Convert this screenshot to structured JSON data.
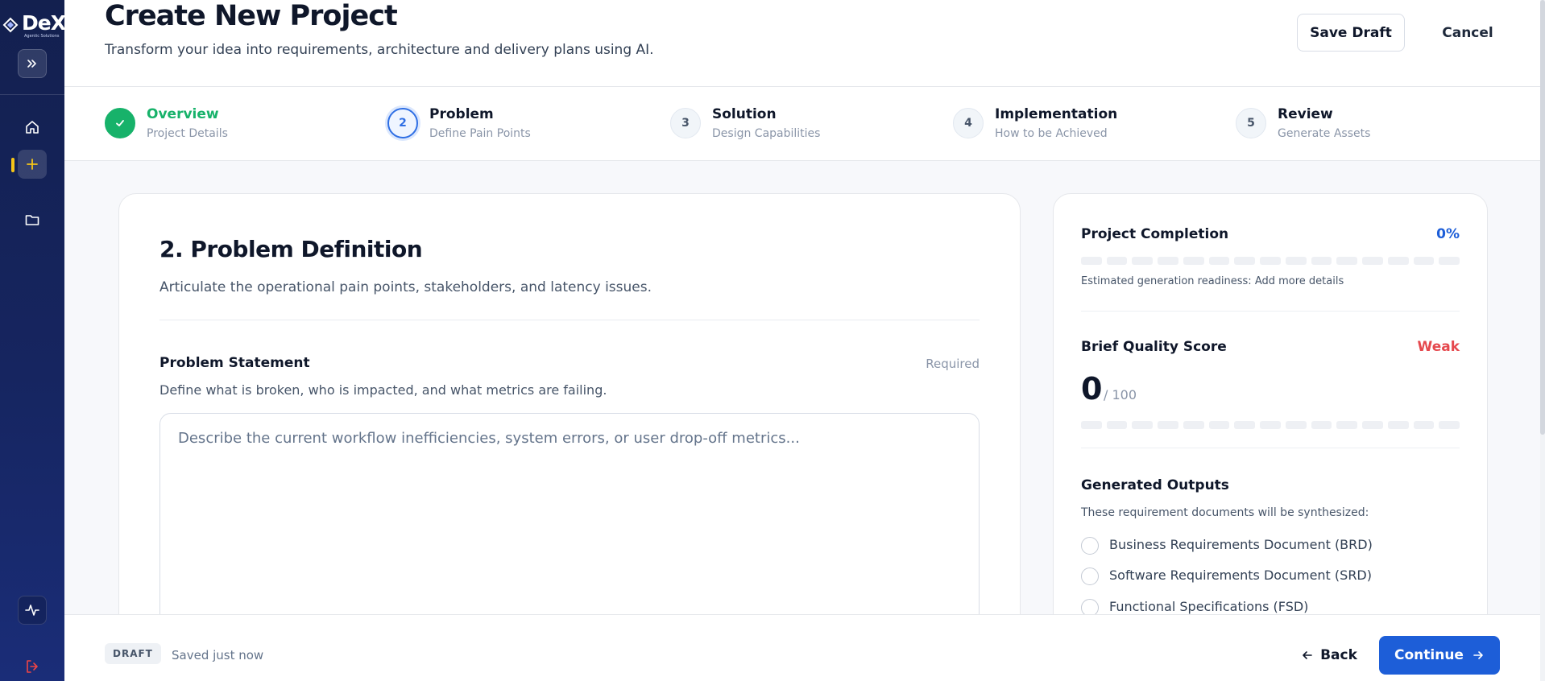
{
  "app": {
    "logo_text": "DeX",
    "logo_subtitle": "Agentic Solutions"
  },
  "sidebar": {
    "items": [
      {
        "name": "expand",
        "icon": "double-chevron-right-icon"
      },
      {
        "name": "home",
        "icon": "home-icon"
      },
      {
        "name": "new-project",
        "icon": "plus-icon",
        "active": true
      },
      {
        "name": "projects",
        "icon": "folder-icon"
      },
      {
        "name": "activity",
        "icon": "activity-icon"
      },
      {
        "name": "logout",
        "icon": "logout-icon"
      }
    ],
    "accent_color": "#f5c518"
  },
  "header": {
    "title": "Create New Project",
    "subtitle": "Transform your idea into requirements, architecture and delivery plans using AI.",
    "save_draft_label": "Save Draft",
    "cancel_label": "Cancel"
  },
  "stepper": {
    "steps": [
      {
        "number": "1",
        "title": "Overview",
        "subtitle": "Project Details",
        "state": "done"
      },
      {
        "number": "2",
        "title": "Problem",
        "subtitle": "Define Pain Points",
        "state": "active"
      },
      {
        "number": "3",
        "title": "Solution",
        "subtitle": "Design Capabilities",
        "state": "pending"
      },
      {
        "number": "4",
        "title": "Implementation",
        "subtitle": "How to be Achieved",
        "state": "pending"
      },
      {
        "number": "5",
        "title": "Review",
        "subtitle": "Generate Assets",
        "state": "pending"
      }
    ]
  },
  "main": {
    "section_title": "2. Problem Definition",
    "section_description": "Articulate the operational pain points, stakeholders, and latency issues.",
    "field": {
      "label": "Problem Statement",
      "required_label": "Required",
      "help": "Define what is broken, who is impacted, and what metrics are failing.",
      "value": "",
      "placeholder": "Describe the current workflow inefficiencies, system errors, or user drop-off metrics..."
    }
  },
  "side": {
    "completion": {
      "title": "Project Completion",
      "percent_label": "0%",
      "percent": 0,
      "segments": 15,
      "note": "Estimated generation readiness: Add more details"
    },
    "quality": {
      "title": "Brief Quality Score",
      "status": "Weak",
      "status_color": "#e5484d",
      "score": "0",
      "max": "/ 100",
      "segments": 15
    },
    "outputs": {
      "title": "Generated Outputs",
      "description": "These requirement documents will be synthesized:",
      "items": [
        "Business Requirements Document (BRD)",
        "Software Requirements Document (SRD)",
        "Functional Specifications (FSD)"
      ]
    }
  },
  "footer": {
    "badge": "DRAFT",
    "saved_text": "Saved just now",
    "back_label": "Back",
    "continue_label": "Continue"
  },
  "colors": {
    "primary": "#1d5ed8",
    "success": "#17b26a",
    "active_step": "#2f6fe4",
    "danger": "#e5484d"
  }
}
